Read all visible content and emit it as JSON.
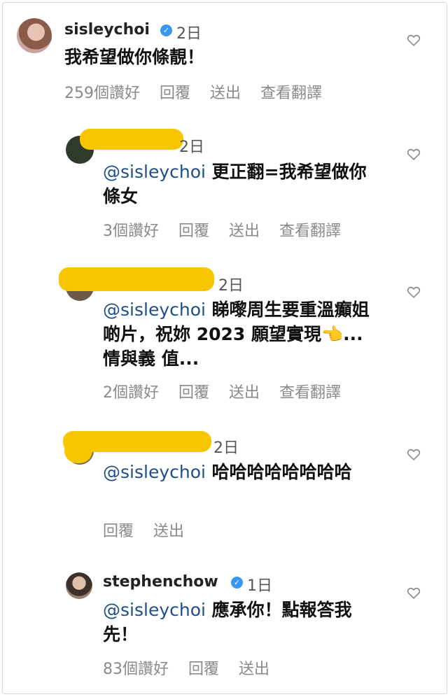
{
  "comments": [
    {
      "username": "sisleychoi",
      "verified": true,
      "time": "2日",
      "mention": "",
      "text": "我希望做你條靚！",
      "likes": "259個讚好",
      "reply": "回覆",
      "send": "送出",
      "translate": "查看翻譯"
    },
    {
      "username": "",
      "time": "2日",
      "mention": "@sisleychoi",
      "text": " 更正翻=我希望做你條女",
      "likes": "3個讚好",
      "reply": "回覆",
      "send": "送出",
      "translate": "查看翻譯"
    },
    {
      "username": "",
      "time": "2日",
      "mention": "@sisleychoi",
      "text": " 睇嚟周生要重溫癲姐啲片，祝妳 2023 願望實現👈...情與義 值...",
      "likes": "2個讚好",
      "reply": "回覆",
      "send": "送出",
      "translate": "查看翻譯"
    },
    {
      "username": "",
      "time": "2日",
      "mention": "@sisleychoi",
      "text": " 哈哈哈哈哈哈哈哈",
      "reply": "回覆",
      "send": "送出"
    },
    {
      "username": "stephenchow",
      "verified": true,
      "time": "1日",
      "mention": "@sisleychoi",
      "text": " 應承你！點報答我先！",
      "likes": "83個讚好",
      "reply": "回覆",
      "send": "送出"
    }
  ],
  "colors": {
    "mention": "#1e4f8c",
    "verified": "#3897f0",
    "mask": "#f7c600"
  },
  "icons": {
    "like": "heart-outline-icon",
    "verified": "verified-badge-icon"
  }
}
